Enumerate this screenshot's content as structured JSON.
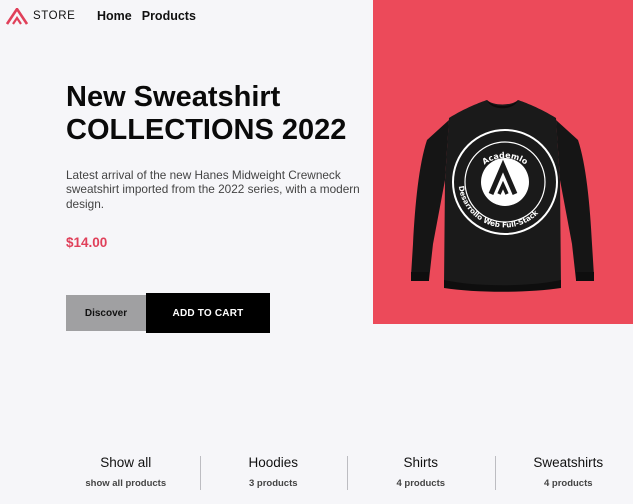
{
  "header": {
    "brand": "STORE",
    "logo_icon": "store-logo-icon",
    "nav": [
      {
        "label": "Home"
      },
      {
        "label": "Products"
      }
    ]
  },
  "hero": {
    "title_line1": "New Sweatshirt",
    "title_line2": "COLLECTIONS 2022",
    "description": "Latest arrival of the new Hanes Midweight Crewneck sweatshirt imported from the 2022 series, with a modern design.",
    "price": "$14.00",
    "discover_label": "Discover",
    "add_to_cart_label": "ADD TO CART",
    "image": {
      "badge_top_text": "Academlo",
      "badge_bottom_text": "Desarrollo Web Full-Stack",
      "panel_color": "#ec4a5a"
    }
  },
  "categories": [
    {
      "name": "Show all",
      "count": "show all products"
    },
    {
      "name": "Hoodies",
      "count": "3 products"
    },
    {
      "name": "Shirts",
      "count": "4 products"
    },
    {
      "name": "Sweatshirts",
      "count": "4 products"
    }
  ],
  "colors": {
    "accent": "#ec4a5a",
    "price": "#e0405a",
    "background": "#f6f6f9"
  }
}
